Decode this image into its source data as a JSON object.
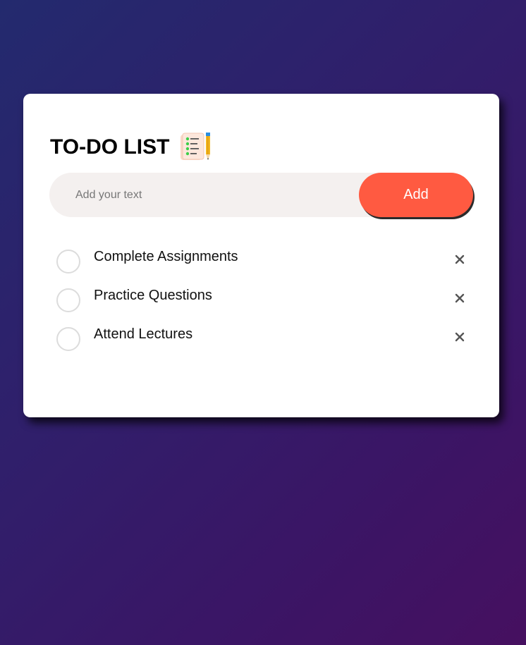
{
  "app": {
    "title": "TO-DO LIST",
    "title_icon": "checklist-pencil-icon"
  },
  "input": {
    "placeholder": "Add your text",
    "value": "",
    "add_label": "Add"
  },
  "tasks": [
    {
      "text": "Complete Assignments",
      "completed": false,
      "remove_icon": "close-icon"
    },
    {
      "text": "Practice Questions",
      "completed": false,
      "remove_icon": "close-icon"
    },
    {
      "text": "Attend Lectures",
      "completed": false,
      "remove_icon": "close-icon"
    }
  ],
  "colors": {
    "accent": "#ff5a41",
    "input_bg": "#f4f0ef",
    "card_bg": "#ffffff",
    "circle_border": "#dcdcdc",
    "background_start": "#232a6e",
    "background_end": "#461060"
  }
}
